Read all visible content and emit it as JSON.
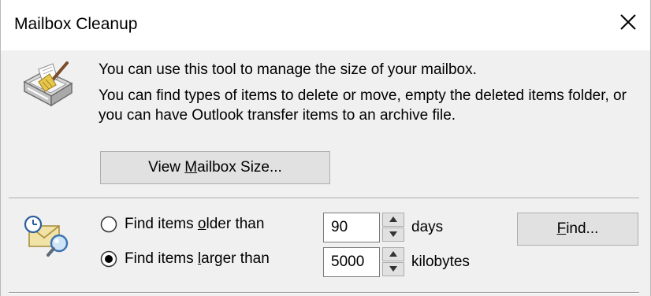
{
  "window": {
    "title": "Mailbox Cleanup"
  },
  "icons": {
    "close": "close-icon",
    "cleanup": "mailbox-cleanup-icon",
    "find": "find-items-icon"
  },
  "description": {
    "line1": "You can use this tool to manage the size of your mailbox.",
    "line2": "You can find types of items to delete or move, empty the deleted items folder, or you can have Outlook transfer items to an archive file."
  },
  "view_mailbox_size": {
    "before": "View ",
    "accel": "M",
    "after": "ailbox Size..."
  },
  "find_options": {
    "older": {
      "label_before": "Find items ",
      "label_accel": "o",
      "label_after": "lder than",
      "value": "90",
      "unit": "days",
      "selected": false
    },
    "larger": {
      "label_before": "Find items ",
      "label_accel": "l",
      "label_after": "arger than",
      "value": "5000",
      "unit": "kilobytes",
      "selected": true
    }
  },
  "find_button": {
    "accel": "F",
    "after": "ind..."
  }
}
